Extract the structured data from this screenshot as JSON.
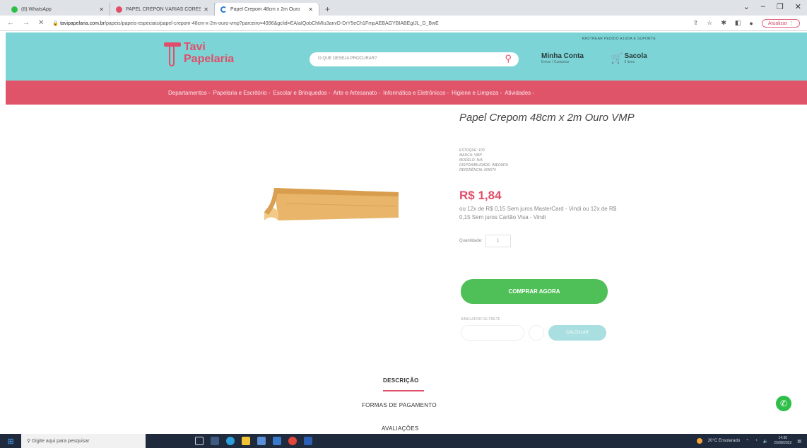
{
  "browser": {
    "tabs": [
      {
        "title": "(8) WhatsApp",
        "icon": "whatsapp-icon",
        "color": "#2fbf48"
      },
      {
        "title": "PAPEL CREPON VÁRIAS CORES",
        "icon": "google-icon",
        "color": "#e04e69"
      },
      {
        "title": "Papel Crepom 48cm x 2m Ouro",
        "icon": "loading-icon",
        "color": "#2a7bd1"
      }
    ],
    "new_tab": "+",
    "url_host": "tavipapelaria.com.br",
    "url_path": "/papeis/papeis-especiais/papel-crepom-48cm-x-2m-ouro-vmp?parceiro=4996&gclid=EAIaIQobChMIu3anvD-DrY5eCh1FmpAEBAGYBIABEgIJL_D_BwE",
    "update_label": "Atualizar"
  },
  "header": {
    "top_links": "RASTREAR PEDIDO    AJUDA E SUPORTE",
    "logo_line1": "Tavi",
    "logo_line2": "Papelaria",
    "search_placeholder": "O QUE DESEJA PROCURAR?",
    "account_title": "Minha Conta",
    "account_sub": "Entrar / Cadastrar",
    "cart_title": "Sacola",
    "cart_sub": "0 itens"
  },
  "nav": {
    "items": [
      "Departamentos -",
      "Papelaria e Escritório -",
      "Escolar e Brinquedos -",
      "Arte e Artesanato -",
      "Informática e Eletrônicos -",
      "Higiene e Limpeza -",
      "Atividades -"
    ]
  },
  "product": {
    "title": "Papel Crepom 48cm x 2m Ouro VMP",
    "specs": [
      "ESTOQUE: 100",
      "MARCA: VMP",
      "MODELO: N/A",
      "DISPONIBILIDADE: IMEDIATA",
      "REFERÊNCIA: 005574"
    ],
    "price": "R$ 1,84",
    "installments": "ou 12x de R$ 0,15 Sem juros MasterCard - Vindi ou 12x de R$ 0,15 Sem juros Cartão Visa - Vindi",
    "qty_label": "Quantidade:",
    "qty_value": "1",
    "buy_label": "COMPRAR AGORA",
    "freight_label": "SIMULADOR DE FRETE",
    "calc_label": "CALCULAR"
  },
  "tabs": {
    "description": "DESCRIÇÃO",
    "payment": "FORMAS DE PAGAMENTO",
    "reviews": "AVALIAÇÕES"
  },
  "taskbar": {
    "search_placeholder": "Digite aqui para pesquisar",
    "weather": "20°C Ensolarado",
    "time": "14:30",
    "date": "25/08/2022"
  },
  "colors": {
    "brand_teal": "#7dd4d6",
    "brand_pink": "#e04e69",
    "buy_green": "#4fbf57"
  }
}
